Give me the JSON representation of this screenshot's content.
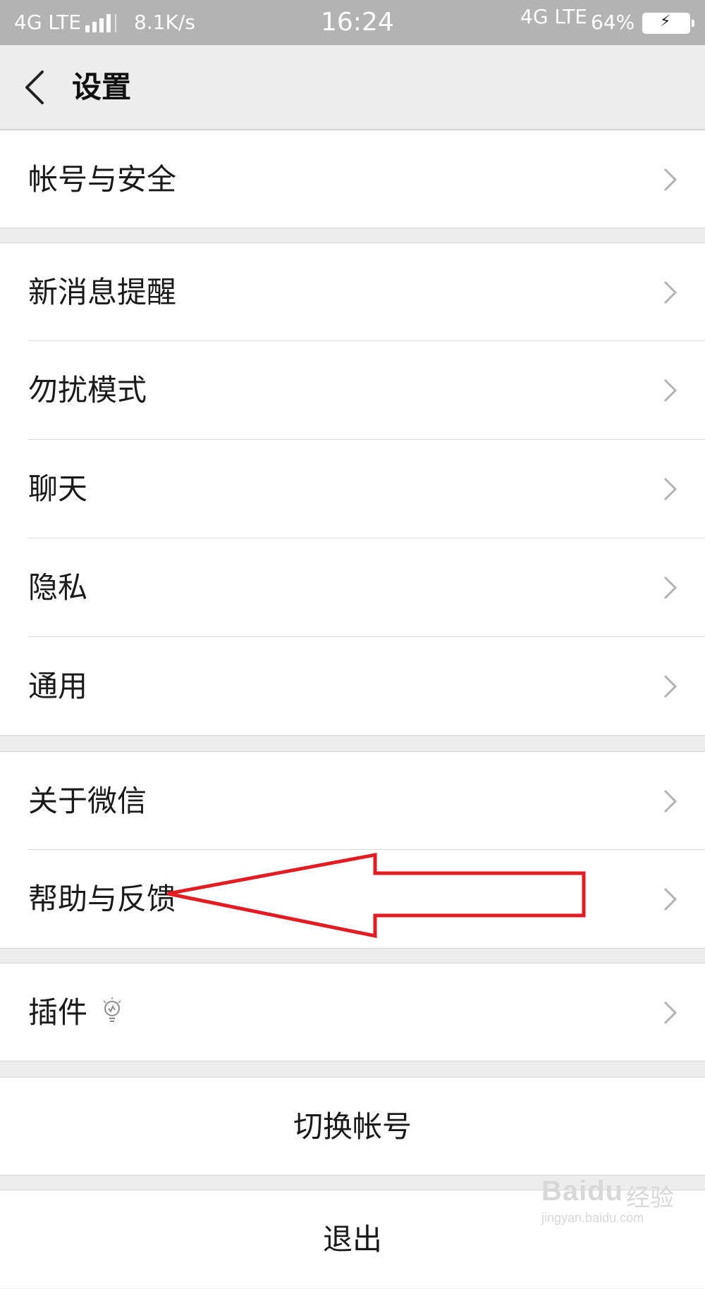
{
  "status_bar": {
    "left_network": "4G LTE",
    "speed": "8.1K/s",
    "time": "16:24",
    "right_network": "4G LTE",
    "battery": "64%",
    "bar_color": "#b3b3b3"
  },
  "nav": {
    "title": "设置",
    "back_icon": "chevron-left-icon"
  },
  "groups": {
    "account": {
      "items": [
        {
          "label": "帐号与安全"
        }
      ]
    },
    "settings": {
      "items": [
        {
          "label": "新消息提醒"
        },
        {
          "label": "勿扰模式"
        },
        {
          "label": "聊天"
        },
        {
          "label": "隐私"
        },
        {
          "label": "通用"
        }
      ]
    },
    "about": {
      "items": [
        {
          "label": "关于微信"
        },
        {
          "label": "帮助与反馈"
        }
      ]
    },
    "plugins": {
      "items": [
        {
          "label": "插件",
          "icon": "lightbulb-icon"
        }
      ]
    }
  },
  "actions": {
    "switch_account": "切换帐号",
    "logout": "退出"
  },
  "annotation": {
    "arrow_color": "#e31b23",
    "target": "帮助与反馈"
  },
  "watermark": {
    "brand": "Baidu",
    "cn": "经验",
    "url": "jingyan.baidu.com"
  }
}
